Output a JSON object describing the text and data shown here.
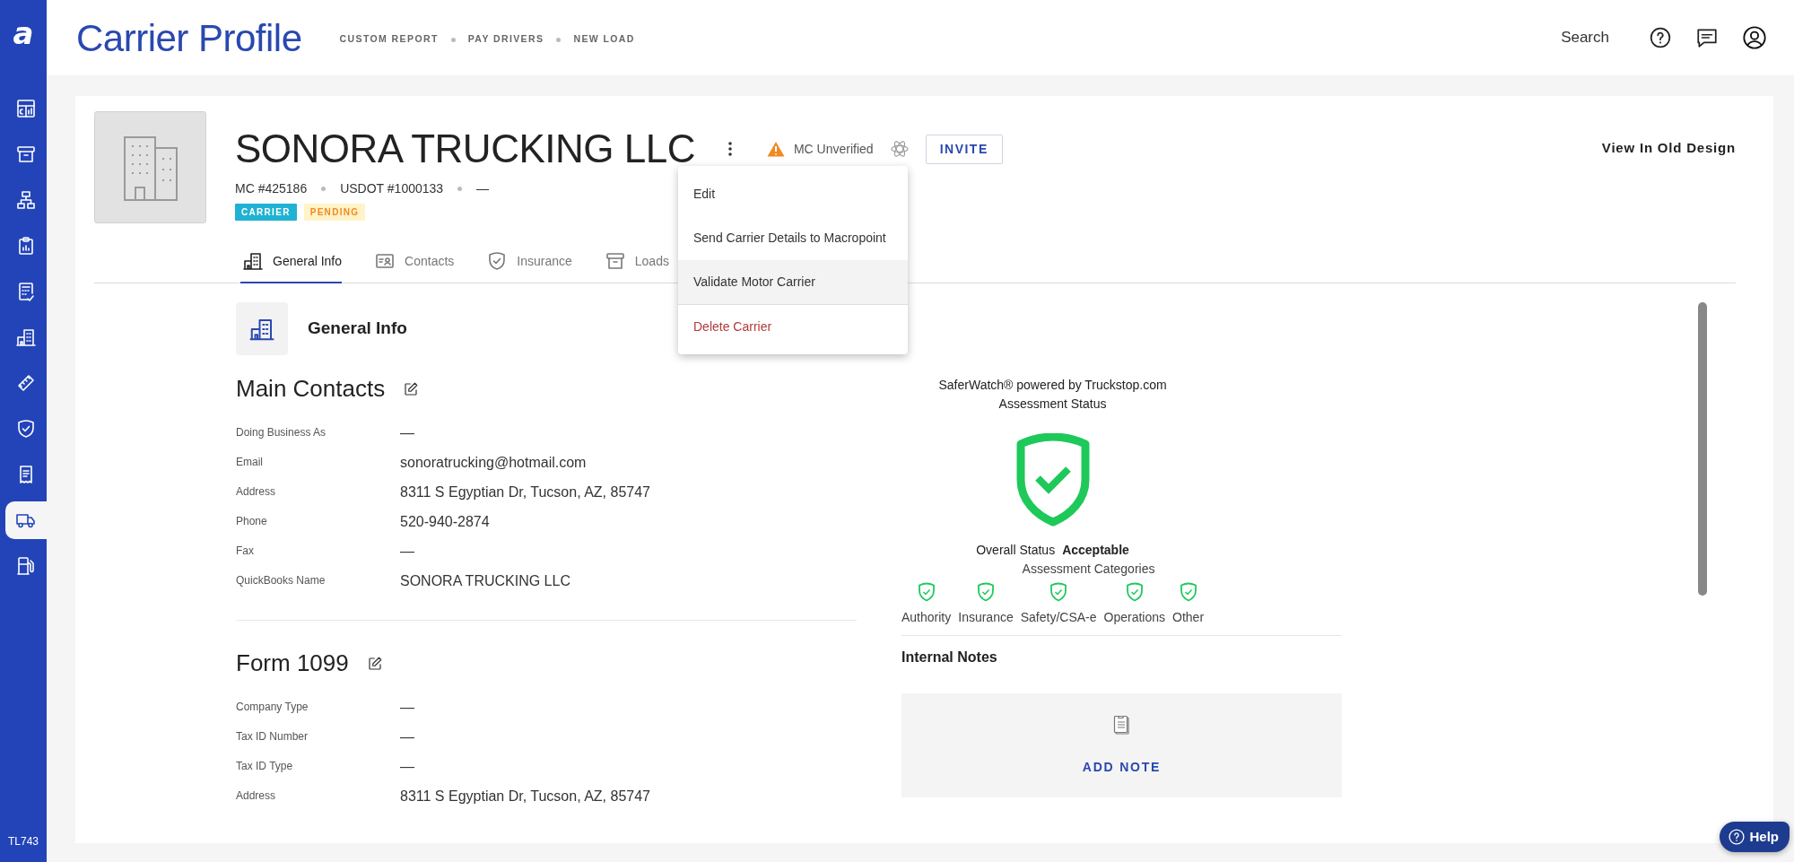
{
  "sidebar": {
    "logo": "a",
    "items": [
      {
        "selected": false
      },
      {
        "selected": false
      },
      {
        "selected": false
      },
      {
        "selected": false
      },
      {
        "selected": false
      },
      {
        "selected": false
      },
      {
        "selected": false
      },
      {
        "selected": false
      },
      {
        "selected": false
      },
      {
        "selected": true
      },
      {
        "selected": false
      }
    ],
    "footer": "TL743"
  },
  "header": {
    "title": "Carrier Profile",
    "links": [
      "CUSTOM REPORT",
      "PAY DRIVERS",
      "NEW LOAD"
    ],
    "search": "Search"
  },
  "carrier": {
    "name": "SONORA TRUCKING LLC",
    "mc_status": "MC Unverified",
    "invite": "INVITE",
    "ids": [
      "MC #425186",
      "USDOT #1000133",
      "—"
    ],
    "tags": [
      {
        "label": "CARRIER",
        "kind": "info",
        "color": "#20b2d3"
      },
      {
        "label": "PENDING",
        "kind": "warning",
        "color": "#fff3c7"
      }
    ],
    "old_design_link": "View In Old Design"
  },
  "tabs": [
    {
      "label": "General Info",
      "selected": true
    },
    {
      "label": "Contacts",
      "selected": false
    },
    {
      "label": "Insurance",
      "selected": false
    },
    {
      "label": "Loads",
      "selected": false
    }
  ],
  "menu": {
    "items": [
      {
        "label": "Edit",
        "kind": "normal",
        "hovered": false
      },
      {
        "label": "Send Carrier Details to Macropoint",
        "kind": "normal",
        "hovered": false
      },
      {
        "label": "Validate Motor Carrier",
        "kind": "normal",
        "hovered": true
      },
      {
        "label": "Delete Carrier",
        "kind": "danger",
        "hovered": false
      }
    ]
  },
  "section_title": "General Info",
  "main_contacts": {
    "title": "Main Contacts",
    "fields": [
      {
        "label": "Doing Business As",
        "value": "—"
      },
      {
        "label": "Email",
        "value": "sonoratrucking@hotmail.com"
      },
      {
        "label": "Address",
        "value": "8311 S Egyptian Dr, Tucson, AZ, 85747"
      },
      {
        "label": "Phone",
        "value": "520-940-2874"
      },
      {
        "label": "Fax",
        "value": "—"
      },
      {
        "label": "QuickBooks Name",
        "value": "SONORA TRUCKING LLC"
      }
    ]
  },
  "form_1099": {
    "title": "Form 1099",
    "fields": [
      {
        "label": "Company Type",
        "value": "—"
      },
      {
        "label": "Tax ID Number",
        "value": "—"
      },
      {
        "label": "Tax ID Type",
        "value": "—"
      },
      {
        "label": "Address",
        "value": "8311 S Egyptian Dr, Tucson, AZ, 85747"
      }
    ]
  },
  "saferwatch": {
    "title": "SaferWatch® powered by Truckstop.com",
    "subtitle": "Assessment Status",
    "overall_label": "Overall Status",
    "overall_value": "Acceptable",
    "categories_title": "Assessment Categories",
    "categories": [
      "Authority",
      "Insurance",
      "Safety/CSA-e",
      "Operations",
      "Other"
    ]
  },
  "internal_notes": {
    "title": "Internal Notes",
    "add": "ADD NOTE"
  },
  "help": "Help"
}
